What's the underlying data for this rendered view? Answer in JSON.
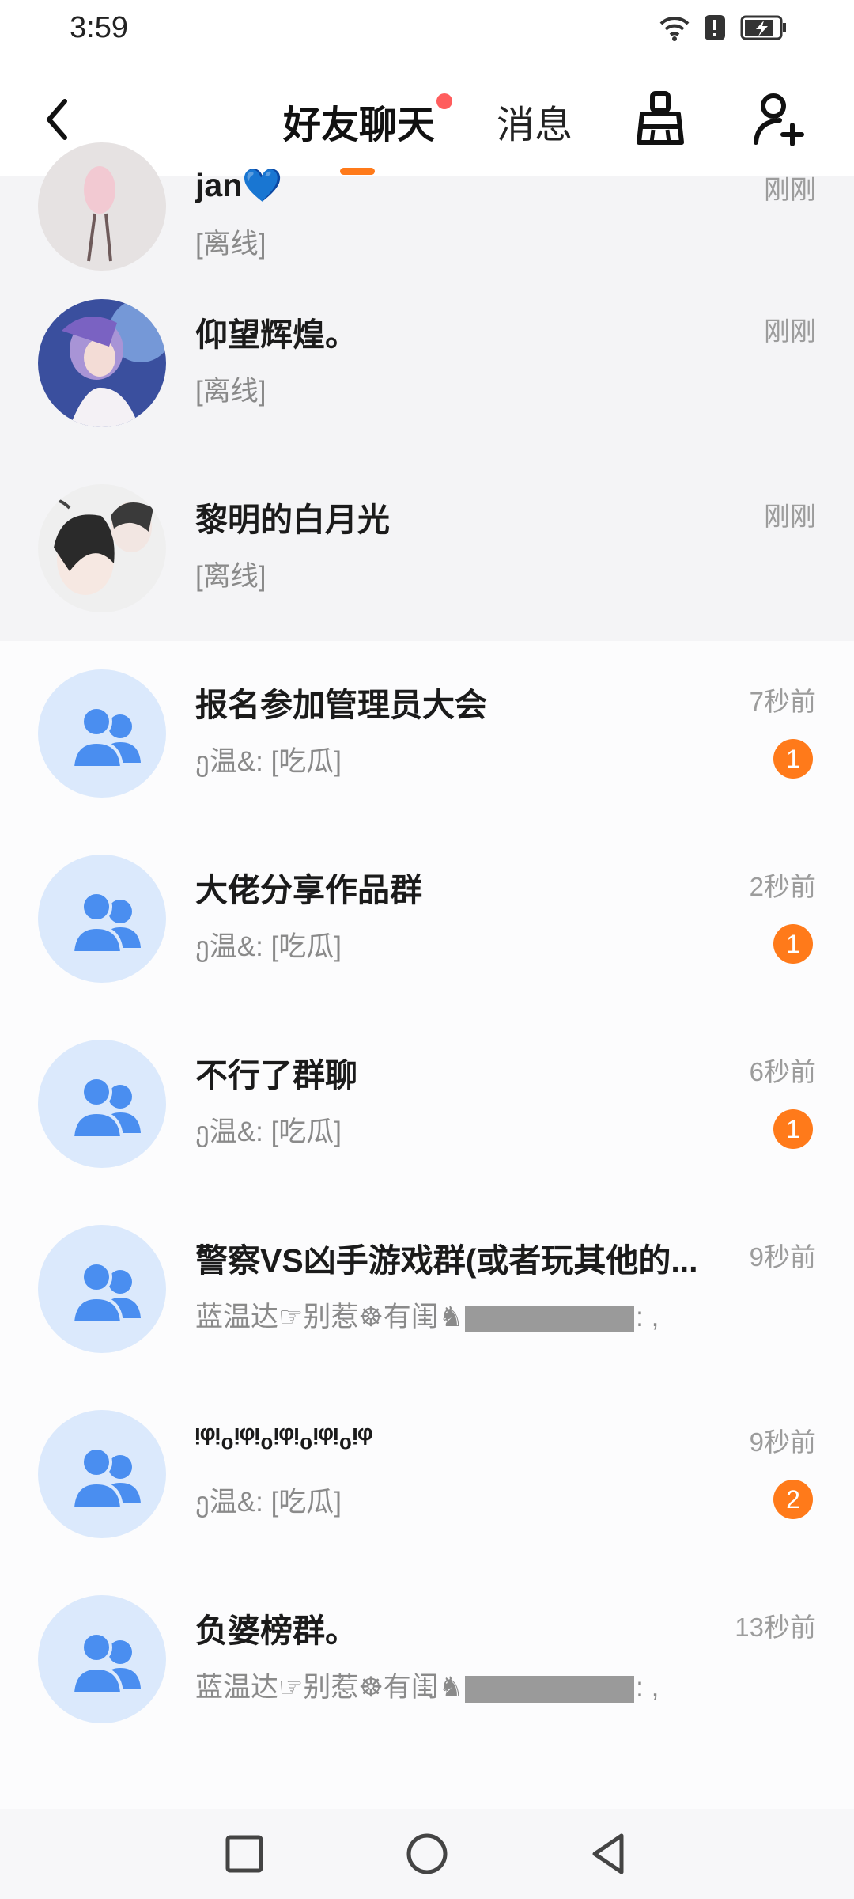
{
  "status_bar": {
    "time": "3:59"
  },
  "header": {
    "tabs": [
      {
        "label": "好友聊天",
        "active": true,
        "has_dot": true
      },
      {
        "label": "消息",
        "active": false
      }
    ]
  },
  "friends": [
    {
      "name": "jan💙",
      "status": "[离线]",
      "time": "刚刚"
    },
    {
      "name": "仰望辉煌。",
      "status": "[离线]",
      "time": "刚刚"
    },
    {
      "name": "黎明的白月光",
      "status": "[离线]",
      "time": "刚刚"
    }
  ],
  "groups": [
    {
      "name": "报名参加管理员大会",
      "last_message": "ე温&: [吃瓜]",
      "time": "7秒前",
      "badge": "1"
    },
    {
      "name": "大佬分享作品群",
      "last_message": "ე温&: [吃瓜]",
      "time": "2秒前",
      "badge": "1"
    },
    {
      "name": "不行了群聊",
      "last_message": "ე温&: [吃瓜]",
      "time": "6秒前",
      "badge": "1"
    },
    {
      "name": "警察VS凶手游戏群(或者玩其他的...",
      "last_message_prefix": "蓝温达☞别惹☸有闺♞",
      "last_message_suffix": ": ,",
      "time": "9秒前"
    },
    {
      "name": "ᵎᵠᵎ₀ᵎᵠᵎ₀ᵎᵠᵎ₀ᵎᵠᵎ₀ᵎᵠ",
      "last_message": "ე温&: [吃瓜]",
      "time": "9秒前",
      "badge": "2"
    },
    {
      "name": "负婆榜群。",
      "last_message_prefix": "蓝温达☞别惹☸有闺♞",
      "last_message_suffix": ": ,",
      "time": "13秒前"
    }
  ],
  "colors": {
    "accent": "#ff7a1a",
    "tab_dot": "#ff5d5d",
    "group_avatar_bg": "#dbe9fc",
    "group_icon": "#4a8ef0"
  },
  "icons": [
    "back-arrow-icon",
    "broom-icon",
    "add-friend-icon",
    "wifi-icon",
    "alert-icon",
    "battery-icon",
    "group-icon",
    "recent-apps-icon",
    "home-icon",
    "back-icon"
  ]
}
